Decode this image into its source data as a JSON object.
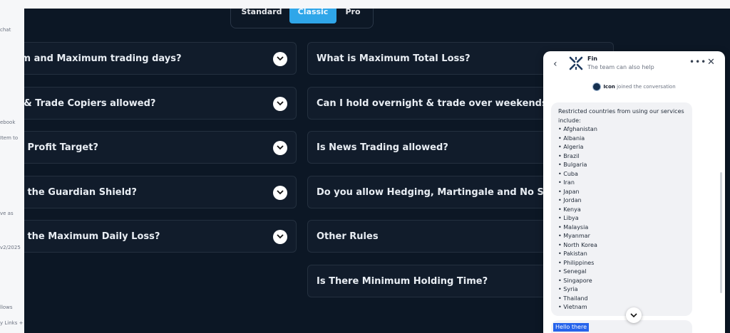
{
  "tabs": {
    "items": [
      "Standard",
      "Classic",
      "Pro"
    ],
    "active": "Classic"
  },
  "faq_left": [
    "num and Maximum trading days?",
    "As & Trade Copiers allowed?",
    "t is Profit Target?",
    "t is the Guardian Shield?",
    "t is the Maximum Daily Loss?"
  ],
  "faq_right": [
    "What is Maximum Total Loss?",
    "Can I hold overnight & trade over weekends?",
    "Is News Trading allowed?",
    "Do you allow Hedging, Martingale and No Stop Loss?",
    "Other Rules",
    "Is There Minimum Holding Time?"
  ],
  "left_fragments": [
    "chat",
    "ebook",
    "Item to",
    "ve as",
    "v2/2025",
    "llows",
    "y Links +"
  ],
  "chat": {
    "agent_name": "Fin",
    "subtitle": "The team can also help",
    "joined_name": "Icon",
    "joined_text": "joined the conversation",
    "message_intro": "Restricted countries from using our services include:",
    "countries": [
      "Afghanistan",
      "Albania",
      "Algeria",
      "Brazil",
      "Bulgaria",
      "Cuba",
      "Iran",
      "Japan",
      "Jordan",
      "Kenya",
      "Libya",
      "Malaysia",
      "Myanmar",
      "North Korea",
      "Pakistan",
      "Philippines",
      "Senegal",
      "Singapore",
      "Syria",
      "Thailand",
      "Vietnam"
    ],
    "next_message": "Hello there"
  },
  "colors": {
    "accent": "#2fa6e9",
    "background": "#0c1725",
    "card": "#111c2b"
  }
}
